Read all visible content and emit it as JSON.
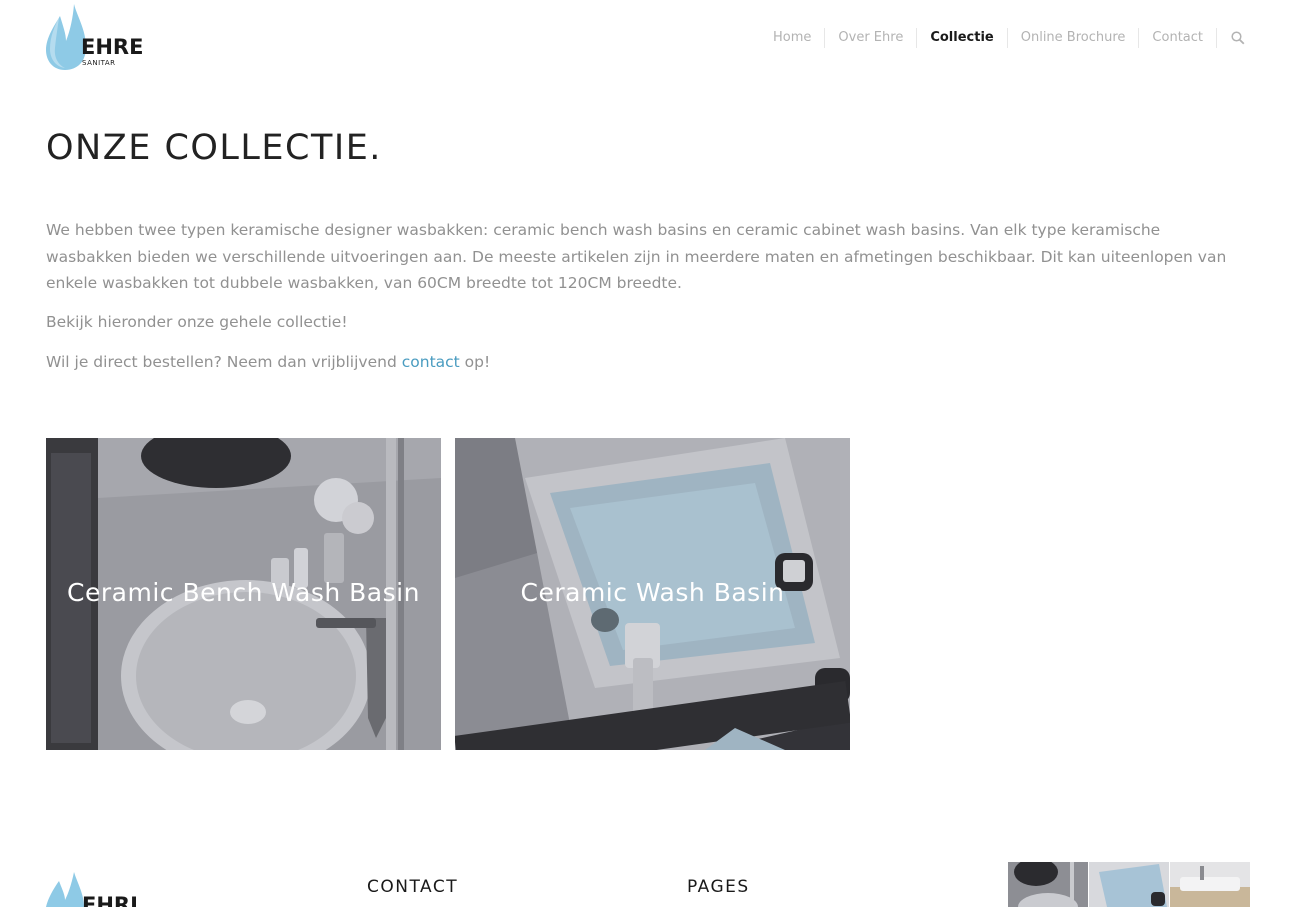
{
  "brand": {
    "name": "EHRE",
    "sub": "SANITAR",
    "drop_color": "#8ecae6"
  },
  "nav": {
    "items": [
      "Home",
      "Over Ehre",
      "Collectie",
      "Online Brochure",
      "Contact"
    ],
    "active": "Collectie",
    "search_icon": "search-icon"
  },
  "main": {
    "title": "ONZE COLLECTIE.",
    "intro": "We hebben twee typen keramische designer wasbakken: ceramic bench wash basins en ceramic cabinet wash basins. Van elk type keramische wasbakken bieden we verschillende uitvoeringen aan. De meeste artikelen zijn in meerdere maten en afmetingen beschikbaar. Dit kan uiteenlopen van enkele wasbakken tot dubbele wasbakken, van 60CM breedte tot 120CM breedte.",
    "p2": "Bekijk hieronder onze gehele collectie!",
    "p3_before": "Wil je direct bestellen? Neem dan vrijblijvend ",
    "p3_link": "contact",
    "p3_after": " op!",
    "link_color": "#4a9cc0"
  },
  "tiles": [
    {
      "label": "Ceramic Bench Wash Basin"
    },
    {
      "label": "Ceramic Wash Basin"
    }
  ],
  "footer": {
    "contact_heading": "CONTACT",
    "pages_heading": "PAGES"
  }
}
